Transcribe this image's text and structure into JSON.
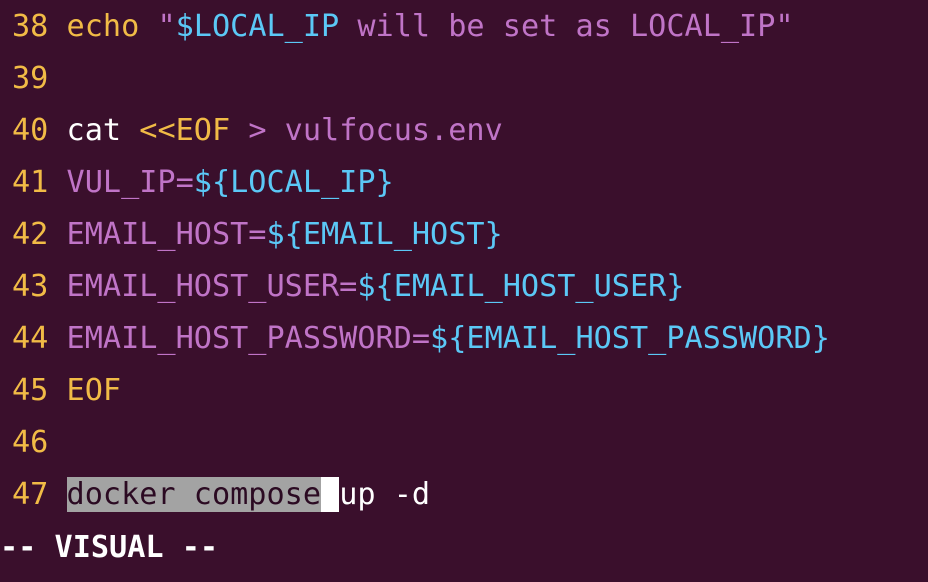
{
  "editor": {
    "lines": [
      {
        "num": "38",
        "segments": [
          "echo",
          " ",
          "\"",
          "$LOCAL_IP",
          " will be set as LOCAL_IP",
          "\""
        ]
      },
      {
        "num": "39",
        "segments": []
      },
      {
        "num": "40",
        "segments": [
          "cat",
          " ",
          "<<EOF",
          " > ",
          "vulfocus.env"
        ]
      },
      {
        "num": "41",
        "segments": [
          "VUL_IP=",
          "${LOCAL_IP}"
        ]
      },
      {
        "num": "42",
        "segments": [
          "EMAIL_HOST=",
          "${EMAIL_HOST}"
        ]
      },
      {
        "num": "43",
        "segments": [
          "EMAIL_HOST_USER=",
          "${EMAIL_HOST_USER}"
        ]
      },
      {
        "num": "44",
        "segments": [
          "EMAIL_HOST_PASSWORD=",
          "${EMAIL_HOST_PASSWORD}"
        ]
      },
      {
        "num": "45",
        "segments": [
          "EOF"
        ]
      },
      {
        "num": "46",
        "segments": []
      },
      {
        "num": "47",
        "segments": [
          "docker compose",
          " ",
          "up -d"
        ]
      }
    ]
  },
  "status": {
    "mode": "-- VISUAL --"
  },
  "colors": {
    "background": "#3a0f2c",
    "line_number": "#f1bb46",
    "keyword_yellow": "#f1bb46",
    "variable_cyan": "#5bc8f6",
    "string_magenta": "#c074c7",
    "selection": "#a3a3a3",
    "cursor": "#ffffff"
  }
}
